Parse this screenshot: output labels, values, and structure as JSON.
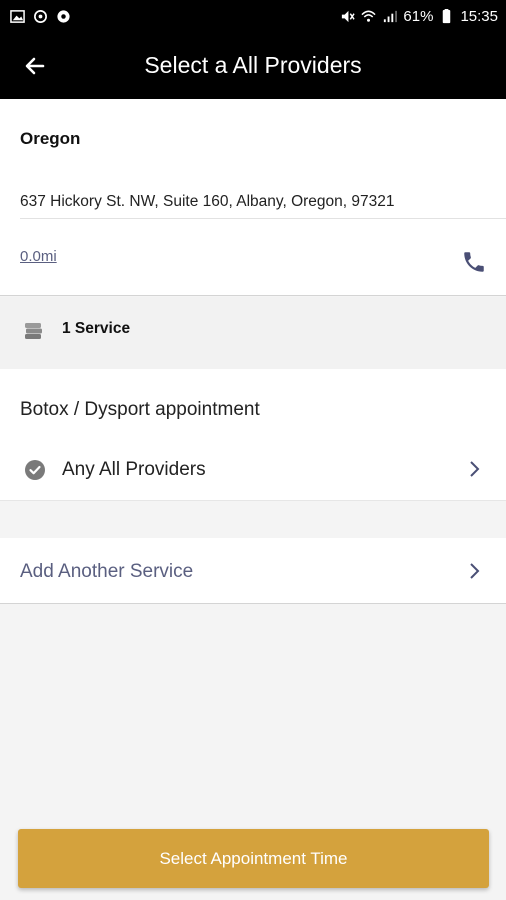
{
  "status_bar": {
    "battery": "61%",
    "time": "15:35",
    "left_icons": [
      "image-icon",
      "sync-icon",
      "settings-icon"
    ],
    "right_icons": [
      "mute-icon",
      "wifi-icon",
      "signal-icon",
      "battery-icon"
    ]
  },
  "header": {
    "title": "Select a All Providers",
    "back_icon": "back-arrow-icon"
  },
  "location": {
    "name": "Oregon",
    "address": "637 Hickory St. NW, Suite 160, Albany, Oregon, 97321",
    "distance": "0.0mi",
    "phone_icon": "phone-icon"
  },
  "services_section": {
    "count_label": "1 Service",
    "icon": "stack-icon"
  },
  "service": {
    "name": "Botox / Dysport appointment",
    "provider": "Any All Providers"
  },
  "add_service": {
    "label": "Add Another Service"
  },
  "footer": {
    "button_label": "Select Appointment Time"
  },
  "colors": {
    "accent_gold": "#d4a23d",
    "link_slate": "#5a5f80",
    "header_black": "#000000"
  }
}
